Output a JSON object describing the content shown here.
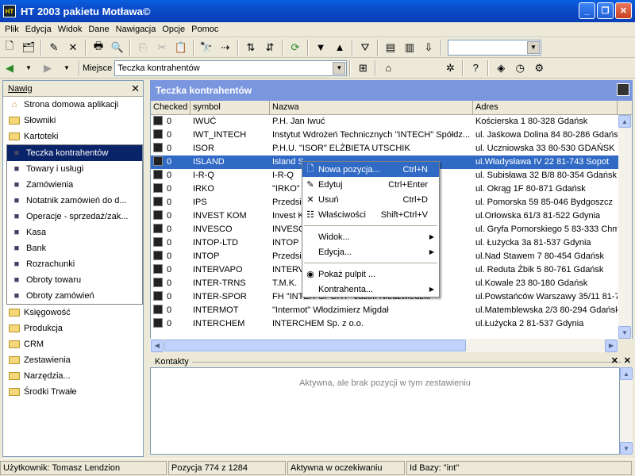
{
  "window": {
    "title": "HT 2003 pakietu Motława©"
  },
  "menubar": [
    "Plik",
    "Edycja",
    "Widok",
    "Dane",
    "Nawigacja",
    "Opcje",
    "Pomoc"
  ],
  "address": {
    "label": "Miejsce",
    "value": "Teczka kontrahentów"
  },
  "nav": {
    "title": "Nawig",
    "items": [
      {
        "label": "Strona domowa aplikacji",
        "icon": "home-icon"
      },
      {
        "label": "Słowniki",
        "icon": "folder-icon"
      },
      {
        "label": "Kartoteki",
        "icon": "folder-open-icon"
      }
    ],
    "subitems": [
      {
        "label": "Teczka kontrahentów",
        "icon": "contacts-book-icon",
        "selected": true
      },
      {
        "label": "Towary i usługi",
        "icon": "products-icon"
      },
      {
        "label": "Zamówienia",
        "icon": "orders-folder-icon"
      },
      {
        "label": "Notatnik zamówień do d...",
        "icon": "notebook-icon"
      },
      {
        "label": "Operacje - sprzedaż/zak...",
        "icon": "operations-icon"
      },
      {
        "label": "Kasa",
        "icon": "cash-register-icon"
      },
      {
        "label": "Bank",
        "icon": "bank-icon"
      },
      {
        "label": "Rozrachunki",
        "icon": "sigma-icon"
      },
      {
        "label": "Obroty towaru",
        "icon": "product-turnover-icon"
      },
      {
        "label": "Obroty zamówień",
        "icon": "order-turnover-icon"
      }
    ],
    "bottom": [
      {
        "label": "Księgowość"
      },
      {
        "label": "Produkcja"
      },
      {
        "label": "CRM"
      },
      {
        "label": "Zestawienia"
      },
      {
        "label": "Narzędzia..."
      },
      {
        "label": "Środki Trwałe"
      }
    ]
  },
  "main": {
    "title": "Teczka kontrahentów",
    "columns": [
      "Checked",
      "symbol",
      "Nazwa",
      "Adres"
    ],
    "rows": [
      {
        "checked": "0",
        "symbol": "IWUĆ",
        "nazwa": "P.H. Jan Iwuć",
        "adres": "Kościerska 1 80-328 Gdańsk"
      },
      {
        "checked": "0",
        "symbol": "IWT_INTECH",
        "nazwa": "Instytut Wdrożeń Technicznych \"INTECH\" Spółdz...",
        "adres": "ul. Jaśkowa Dolina 84 80-286 Gdańsk"
      },
      {
        "checked": "0",
        "symbol": "ISOR",
        "nazwa": "P.H.U. \"ISOR\" ELŻBIETA UTSCHIK",
        "adres": "ul. Uczniowska 33 80-530 GDAŃSK"
      },
      {
        "checked": "0",
        "symbol": "ISLAND",
        "nazwa": "Island S",
        "adres": "ul.Władysława IV 22 81-743 Sopot",
        "selected": true
      },
      {
        "checked": "0",
        "symbol": "I-R-Q",
        "nazwa": "I-R-Q",
        "adres": "ul. Subisława 32 B/8 80-354 Gdańsk"
      },
      {
        "checked": "0",
        "symbol": "IRKO",
        "nazwa": "\"IRKO\"",
        "adres": "ul. Okrąg 1F 80-871 Gdańsk"
      },
      {
        "checked": "0",
        "symbol": "IPS",
        "nazwa": "Przedsi",
        "adres": "ul. Pomorska 59  85-046 Bydgoszcz"
      },
      {
        "checked": "0",
        "symbol": "INVEST KOM",
        "nazwa": "Invest K",
        "adres": "ul.Orłowska 61/3 81-522 Gdynia"
      },
      {
        "checked": "0",
        "symbol": "INVESCO",
        "nazwa": "INVESCO",
        "adres": "ul. Gryfa Pomorskiego 5 83-333 Chmie"
      },
      {
        "checked": "0",
        "symbol": "INTOP-LTD",
        "nazwa": "INTOP",
        "adres": "ul. Łużycka 3a 81-537 Gdynia"
      },
      {
        "checked": "0",
        "symbol": "INTOP",
        "nazwa": "Przedsie",
        "adres": "ul.Nad Stawem 7 80-454 Gdańsk"
      },
      {
        "checked": "0",
        "symbol": "INTERVAPO",
        "nazwa": "INTERV",
        "adres": "ul. Reduta Żbik 5 80-761 Gdańsk"
      },
      {
        "checked": "0",
        "symbol": "INTER-TRNS",
        "nazwa": "T.M.K.",
        "adres": "ul.Kowale 23 80-180 Gdańsk"
      },
      {
        "checked": "0",
        "symbol": "INTER-SPOR",
        "nazwa": "FH \"INTER-SPORT\" Jacek Niedźwiedzki",
        "adres": "ul.Powstańców Warszawy 35/11 81-7"
      },
      {
        "checked": "0",
        "symbol": "INTERMOT",
        "nazwa": "\"Intermot\" Włodzimierz Migdał",
        "adres": "ul.Matemblewska 2/3 80-294 Gdańsk"
      },
      {
        "checked": "0",
        "symbol": "INTERCHEM",
        "nazwa": "INTERCHEM Sp. z o.o.",
        "adres": "ul.Łużycka 2 81-537 Gdynia"
      }
    ]
  },
  "context_menu": [
    {
      "label": "Nowa pozycja...",
      "shortcut": "Ctrl+N",
      "icon": "new-doc-icon",
      "highlight": true
    },
    {
      "label": "Edytuj",
      "shortcut": "Ctrl+Enter",
      "icon": "edit-icon"
    },
    {
      "label": "Usuń",
      "shortcut": "Ctrl+D",
      "icon": "delete-icon"
    },
    {
      "label": "Właściwości",
      "shortcut": "Shift+Ctrl+V",
      "icon": "properties-icon"
    },
    {
      "sep": true
    },
    {
      "label": "Widok...",
      "submenu": true
    },
    {
      "label": "Edycja...",
      "submenu": true
    },
    {
      "sep": true
    },
    {
      "label": "Pokaż pulpit ...",
      "icon": "desktop-icon"
    },
    {
      "label": "Kontrahenta...",
      "submenu": true
    }
  ],
  "kontakty": {
    "title": "Kontakty",
    "empty": "Aktywna, ale brak pozycji w tym zestawieniu"
  },
  "status": {
    "user": "Użytkownik: Tomasz Lendzion",
    "position": "Pozycja 774 z 1284",
    "state": "Aktywna w oczekiwaniu",
    "db": "Id Bazy: \"int\""
  }
}
